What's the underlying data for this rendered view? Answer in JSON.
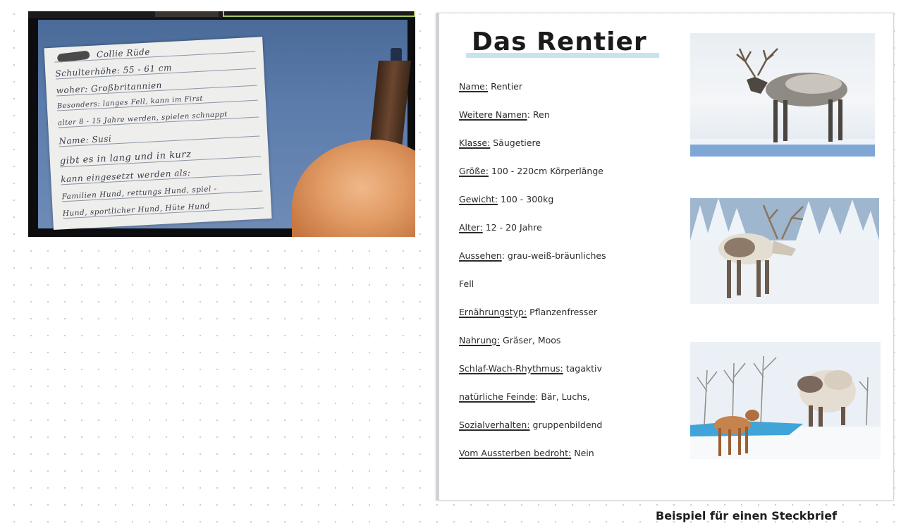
{
  "webcam": {
    "handwriting_lines": [
      "Collie Rüde",
      "Schulterhöhe: 55 - 61 cm",
      "woher: Großbritannien",
      "Besonders: langes Fell, kann im First",
      "alter 8 - 15 Jahre werden, spielen schnappt",
      "Name: Susi",
      "gibt es in lang und in kurz",
      "kann eingesetzt werden als:",
      "Familien Hund, rettungs Hund, spiel -",
      "Hund, sportlicher Hund, Hüte Hund"
    ]
  },
  "card": {
    "title": "Das Rentier",
    "facts": [
      {
        "key": "Name:",
        "value": " Rentier"
      },
      {
        "key": "Weitere Namen",
        "value": ": Ren"
      },
      {
        "key": "Klasse:",
        "value": " Säugetiere"
      },
      {
        "key": "Größe:",
        "value": " 100 - 220cm Körperlänge"
      },
      {
        "key": "Gewicht:",
        "value": " 100 - 300kg"
      },
      {
        "key": "Alter:",
        "value": " 12 - 20 Jahre"
      },
      {
        "key": "Aussehen",
        "value": ": grau-weiß-bräunliches"
      },
      {
        "key": "",
        "value": "Fell"
      },
      {
        "key": "Ernährungstyp:",
        "value": " Pflanzenfresser"
      },
      {
        "key": "Nahrung:",
        "value": " Gräser, Moos"
      },
      {
        "key": "Schlaf-Wach-Rhythmus:",
        "value": " tagaktiv"
      },
      {
        "key": "natürliche Feinde",
        "value": ": Bär, Luchs,"
      },
      {
        "key": "Sozialverhalten:",
        "value": " gruppenbildend"
      },
      {
        "key": "Vom Aussterben bedroht:",
        "value": " Nein"
      }
    ]
  },
  "caption": "Beispiel für einen Steckbrief",
  "colors": {
    "title_underline": "#c7e3ee",
    "webcam_border": "#a8c86a"
  }
}
